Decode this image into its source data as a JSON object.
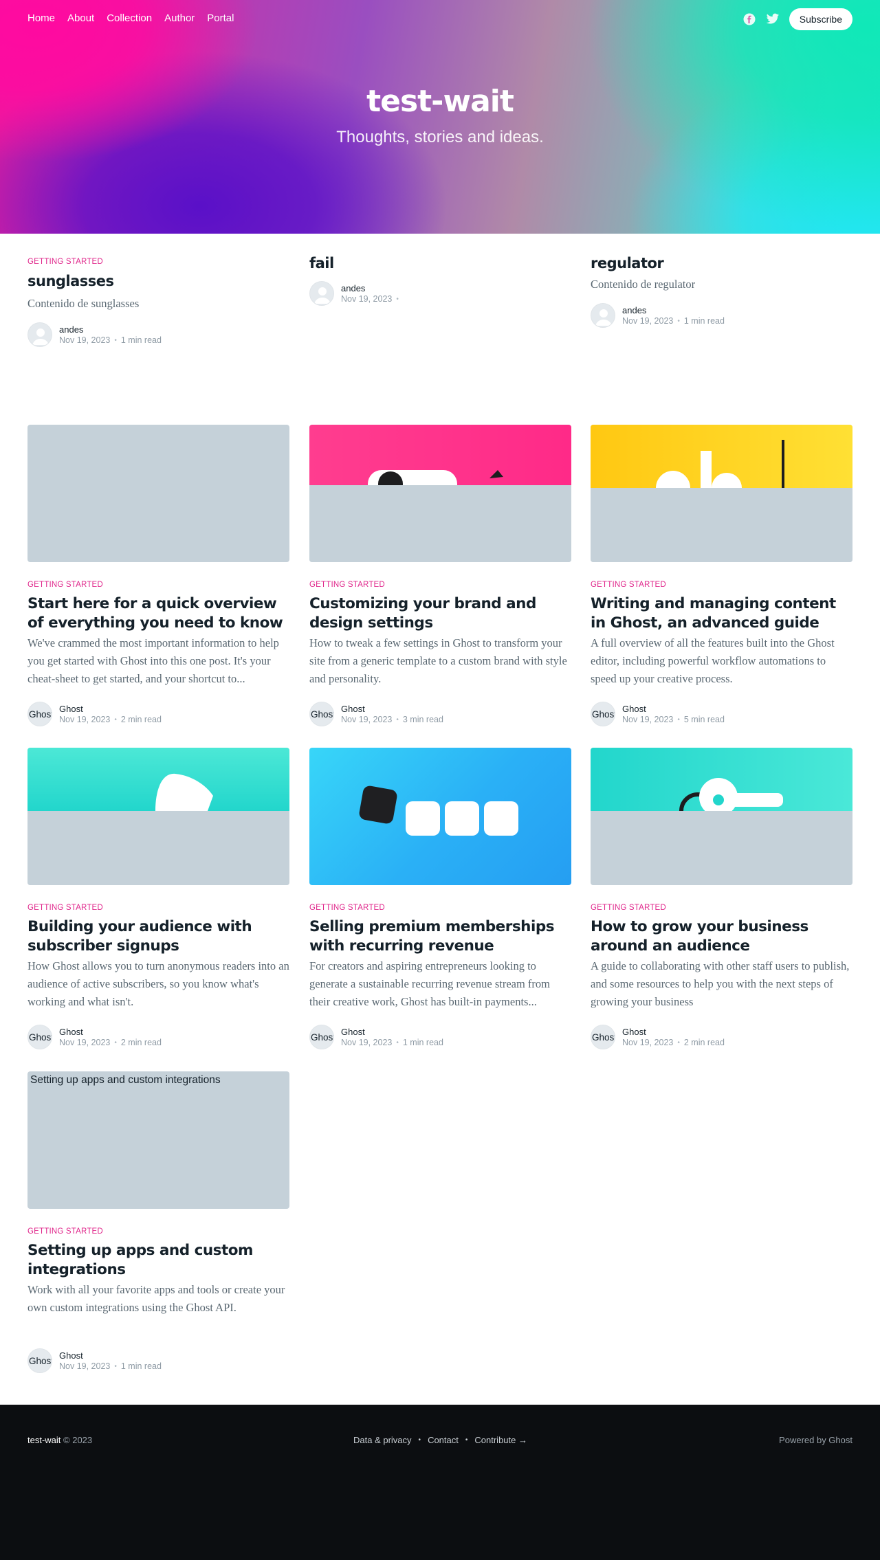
{
  "site": {
    "title": "test-wait",
    "description": "Thoughts, stories and ideas."
  },
  "nav": {
    "items": [
      {
        "label": "Home"
      },
      {
        "label": "About"
      },
      {
        "label": "Collection"
      },
      {
        "label": "Author"
      },
      {
        "label": "Portal"
      }
    ],
    "social_icons": [
      "facebook-icon",
      "twitter-icon"
    ],
    "subscribe_label": "Subscribe"
  },
  "featured": [
    {
      "tag": "Getting Started",
      "title": "sunglasses",
      "excerpt": "Contenido de sunglasses",
      "author": "andes",
      "date": "Nov 19, 2023",
      "reading_time": "1 min read"
    },
    {
      "tag": "",
      "title": "fail",
      "excerpt": "",
      "author": "andes",
      "date": "Nov 19, 2023",
      "reading_time": ""
    },
    {
      "tag": "",
      "title": "regulator",
      "excerpt": "Contenido de regulator",
      "author": "andes",
      "date": "Nov 19, 2023",
      "reading_time": "1 min read"
    }
  ],
  "posts": [
    {
      "tag": "Getting Started",
      "title": "Start here for a quick overview of everything you need to know",
      "excerpt": "We've crammed the most important information to help you get started with Ghost into this one post. It's your cheat-sheet to get started, and your shortcut to...",
      "author": "Ghost",
      "avatar_text": "Ghost",
      "date": "Nov 19, 2023",
      "reading_time": "2 min read",
      "image_alt": ""
    },
    {
      "tag": "Getting Started",
      "title": "Customizing your brand and design settings",
      "excerpt": "How to tweak a few settings in Ghost to transform your site from a generic template to a custom brand with style and personality.",
      "author": "Ghost",
      "avatar_text": "Ghost",
      "date": "Nov 19, 2023",
      "reading_time": "3 min read",
      "image_alt": ""
    },
    {
      "tag": "Getting Started",
      "title": "Writing and managing content in Ghost, an advanced guide",
      "excerpt": "A full overview of all the features built into the Ghost editor, including powerful workflow automations to speed up your creative process.",
      "author": "Ghost",
      "avatar_text": "Ghost",
      "date": "Nov 19, 2023",
      "reading_time": "5 min read",
      "image_alt": ""
    },
    {
      "tag": "Getting Started",
      "title": "Building your audience with subscriber signups",
      "excerpt": "How Ghost allows you to turn anonymous readers into an audience of active subscribers, so you know what's working and what isn't.",
      "author": "Ghost",
      "avatar_text": "Ghost",
      "date": "Nov 19, 2023",
      "reading_time": "2 min read",
      "image_alt": ""
    },
    {
      "tag": "Getting Started",
      "title": "Selling premium memberships with recurring revenue",
      "excerpt": "For creators and aspiring entrepreneurs looking to generate a sustainable recurring revenue stream from their creative work, Ghost has built-in payments...",
      "author": "Ghost",
      "avatar_text": "Ghost",
      "date": "Nov 19, 2023",
      "reading_time": "1 min read",
      "image_alt": ""
    },
    {
      "tag": "Getting Started",
      "title": "How to grow your business around an audience",
      "excerpt": "A guide to collaborating with other staff users to publish, and some resources to help you with the next steps of growing your business",
      "author": "Ghost",
      "avatar_text": "Ghost",
      "date": "Nov 19, 2023",
      "reading_time": "2 min read",
      "image_alt": ""
    },
    {
      "tag": "Getting Started",
      "title": "Setting up apps and custom integrations",
      "excerpt": "Work with all your favorite apps and tools or create your own custom integrations using the Ghost API.",
      "author": "Ghost",
      "avatar_text": "Ghost",
      "date": "Nov 19, 2023",
      "reading_time": "1 min read",
      "image_alt": "Setting up apps and custom integrations"
    }
  ],
  "footer": {
    "site_title": "test-wait",
    "copyright": "© 2023",
    "links": [
      {
        "label": "Data & privacy"
      },
      {
        "label": "Contact"
      },
      {
        "label": "Contribute →"
      }
    ],
    "powered_by": "Powered by Ghost"
  },
  "colors": {
    "accent": "#e0268b",
    "placeholder": "#c5d1d9",
    "footer_bg": "#0c0e11"
  }
}
